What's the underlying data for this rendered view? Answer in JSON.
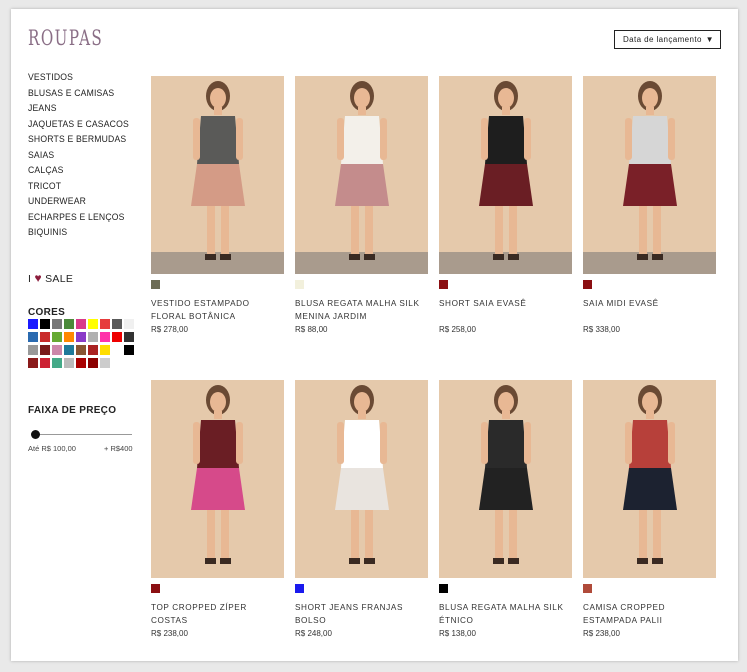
{
  "brand": "ROUPAS",
  "sort": {
    "label": "Data de lançamento",
    "caret": "▼"
  },
  "categories": [
    "VESTIDOS",
    "BLUSAS E CAMISAS",
    "JEANS",
    "JAQUETAS E CASACOS",
    "SHORTS E BERMUDAS",
    "SAIAS",
    "CALÇAS",
    "TRICOT",
    "UNDERWEAR",
    "ECHARPES E LENÇOS",
    "BIQUINIS"
  ],
  "sale": {
    "prefix": "I",
    "label": "SALE"
  },
  "colors": {
    "title": "CORES",
    "swatches": [
      "#1a1aff",
      "#000000",
      "#777777",
      "#4b8a3a",
      "#d93a8a",
      "#ffff00",
      "#e63b3b",
      "#5a5a5a",
      "#f0f0f0",
      "#2a6ab0",
      "#c92b2b",
      "#66aa33",
      "#ff8800",
      "#8a3ac8",
      "#b0b0b0",
      "#ff33aa",
      "#ee0000",
      "#333333",
      "#999999",
      "#7a1b1b",
      "#cc88aa",
      "#1e7a9a",
      "#885533",
      "#aa2222",
      "#ffdd00",
      "#ffffff",
      "#000000",
      "#8a1a1a",
      "#cc2233",
      "#44aa88",
      "#bbbbbb",
      "#aa0000",
      "#8b0000",
      "#cccccc"
    ]
  },
  "price": {
    "title": "FAIXA DE PREÇO",
    "min_label": "Até R$ 100,00",
    "max_label": "+ R$400"
  },
  "products": [
    {
      "name": "VESTIDO ESTAMPADO FLORAL BOTÂNICA",
      "price": "R$ 278,00",
      "swatch": "#6b6b55"
    },
    {
      "name": "BLUSA REGATA MALHA SILK MENINA JARDIM",
      "price": "R$ 88,00",
      "swatch": "#f2f0dc"
    },
    {
      "name": "SHORT SAIA EVASÊ",
      "price": "R$ 258,00",
      "swatch": "#8b0f12"
    },
    {
      "name": "SAIA MIDI EVASÊ",
      "price": "R$ 338,00",
      "swatch": "#8b0f12"
    },
    {
      "name": "TOP CROPPED ZÍPER COSTAS",
      "price": "R$ 238,00",
      "swatch": "#8b0f12"
    },
    {
      "name": "SHORT JEANS FRANJAS BOLSO",
      "price": "R$ 248,00",
      "swatch": "#1a1aee"
    },
    {
      "name": "BLUSA REGATA MALHA SILK ÉTNICO",
      "price": "R$ 138,00",
      "swatch": "#000000"
    },
    {
      "name": "CAMISA CROPPED ESTAMPADA PALII",
      "price": "R$ 238,00",
      "swatch": "#b04a3a"
    }
  ]
}
